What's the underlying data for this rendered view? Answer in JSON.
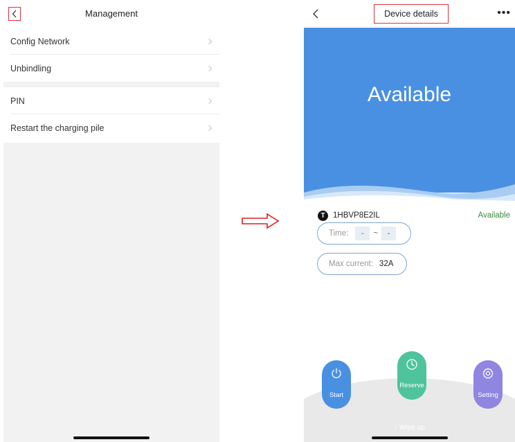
{
  "left": {
    "title": "Management",
    "menu_group_1": [
      {
        "label": "Config Network"
      },
      {
        "label": "Unbindling"
      }
    ],
    "menu_group_2": [
      {
        "label": "PIN"
      },
      {
        "label": "Restart the charging pile"
      }
    ]
  },
  "right": {
    "title": "Device details",
    "more_label": "•••",
    "hero_status": "Available",
    "device": {
      "logo_letter": "T",
      "id": "1HBVP8E2IL",
      "status": "Available"
    },
    "time": {
      "label": "Time:",
      "start": "-",
      "separator": "~",
      "end": "-"
    },
    "max_current": {
      "label": "Max current:",
      "value": "32A"
    },
    "actions": {
      "start": "Start",
      "reserve": "Reserve",
      "setting": "Setting"
    },
    "wipe_hint": "↑ Wipe up"
  },
  "colors": {
    "hero_blue": "#4a90e2",
    "start_blue": "#4a90e2",
    "reserve_green": "#4fc39c",
    "setting_purple": "#8e86e0",
    "status_green": "#3a8a3a",
    "highlight_red": "#d9333b",
    "arrow_red": "#e02020"
  },
  "icons": {
    "left_back": "chevron-left-icon",
    "menu_chevron": "chevron-right-icon",
    "right_back": "chevron-left-icon",
    "more": "more-dots-icon",
    "device_logo": "brand-logo-icon",
    "start": "power-icon",
    "reserve": "clock-icon",
    "setting": "gear-icon",
    "arrow": "arrow-right-icon"
  }
}
